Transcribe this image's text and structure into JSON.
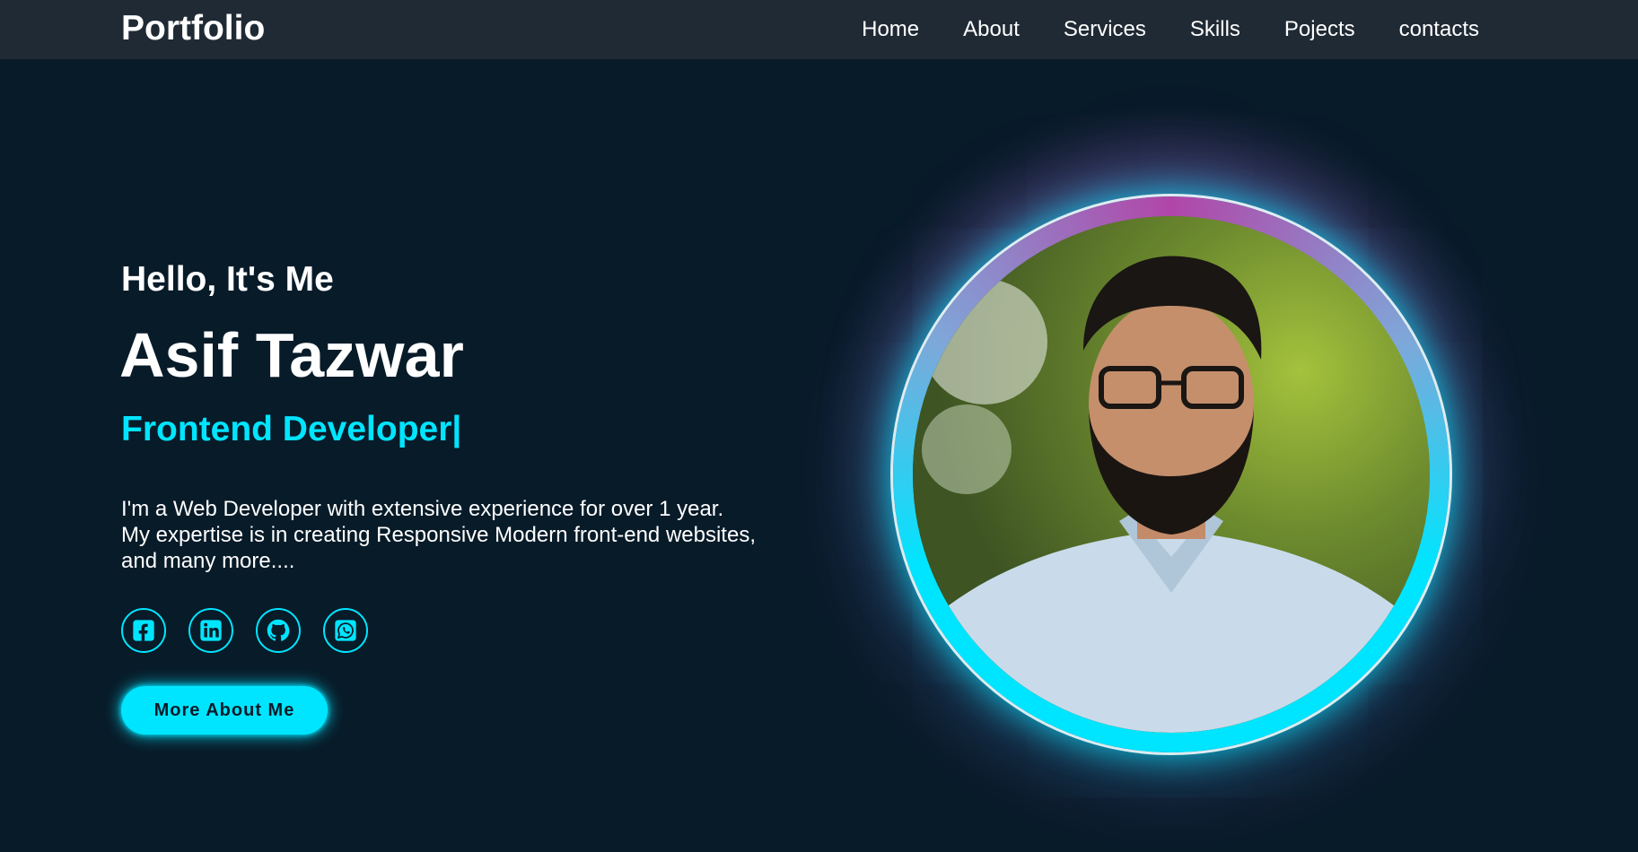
{
  "nav": {
    "logo": "Portfolio",
    "links": [
      "Home",
      "About",
      "Services",
      "Skills",
      "Pojects",
      "contacts"
    ]
  },
  "hero": {
    "greeting": "Hello, It's Me",
    "name": "Asif Tazwar",
    "role": "Frontend Developer",
    "cursor": "|",
    "bio": [
      "I'm a Web Developer with extensive experience for over 1 year.",
      "My expertise is in creating Responsive Modern front-end websites,",
      "and many more...."
    ],
    "socials": [
      "facebook-icon",
      "linkedin-icon",
      "github-icon",
      "whatsapp-icon"
    ],
    "button_label": "More About Me"
  },
  "colors": {
    "background": "#081b29",
    "navbar": "#1f2a35",
    "accent": "#00e5ff",
    "ring_purple": "#b146a8"
  }
}
